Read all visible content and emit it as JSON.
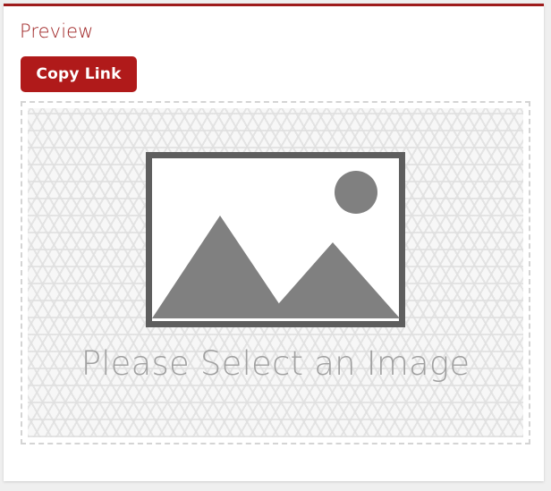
{
  "panel": {
    "title": "Preview",
    "accent_color": "#9e1b1b",
    "background": "#ffffff"
  },
  "toolbar": {
    "copy_link_label": "Copy Link",
    "copy_link_bg": "#b01a1a",
    "copy_link_text_color": "#ffffff"
  },
  "dropzone": {
    "border_color": "#d4d4d4",
    "pattern_color": "#e0e0e0",
    "caption": "Please Select an Image",
    "caption_color": "#a0a0a0",
    "icon": {
      "name": "image-placeholder-icon",
      "frame_color": "#5e5e5e",
      "fill_color": "#ffffff",
      "shape_color": "#808080"
    }
  },
  "page": {
    "background": "#efefef"
  }
}
